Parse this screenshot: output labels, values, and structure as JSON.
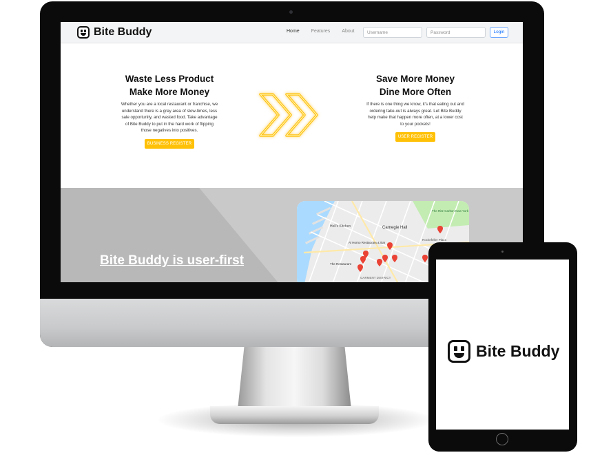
{
  "brand": {
    "name": "Bite Buddy",
    "accent": "#ffc107",
    "logo_icon": "smiley-logo-icon"
  },
  "nav": {
    "links": [
      "Home",
      "Features",
      "About"
    ],
    "active": "Home",
    "username_placeholder": "Username",
    "password_placeholder": "Password",
    "login_label": "Login"
  },
  "hero": {
    "left": {
      "title_line1": "Waste Less Product",
      "title_line2": "Make More Money",
      "text": "Whether you are a local restaurant or franchise, we understand there is a grey area of slow-times, less sale opportunity, and wasted food. Take advantage of Bite Buddy to put in the hard work of flipping those negatives into positives.",
      "button": "BUSINESS REGISTER"
    },
    "right": {
      "title_line1": "Save More Money",
      "title_line2": "Dine More Often",
      "text": "If there is one thing we know, it's that eating out and ordering take-out is always great. Let Bite Buddy help make that happen more often, at a lower cost to your pockets!",
      "button": "USER REGISTER"
    },
    "divider_icon": "double-chevron-right-icon"
  },
  "section": {
    "title": "Bite Buddy is user-first"
  },
  "map": {
    "labels": {
      "hells_kitchen": "Hell's Kitchen",
      "carnegie_hall": "Carnegie Hall",
      "rockefeller": "Rockefeller Plaza",
      "garment": "GARMENT DISTRICT",
      "restaurant_a": "Al Horno Restaurant & Bar",
      "restaurant_b": "The Restaurant",
      "hotel": "The Ritz-Carlton New York"
    }
  },
  "tablet": {
    "brand_name": "Bite Buddy"
  }
}
